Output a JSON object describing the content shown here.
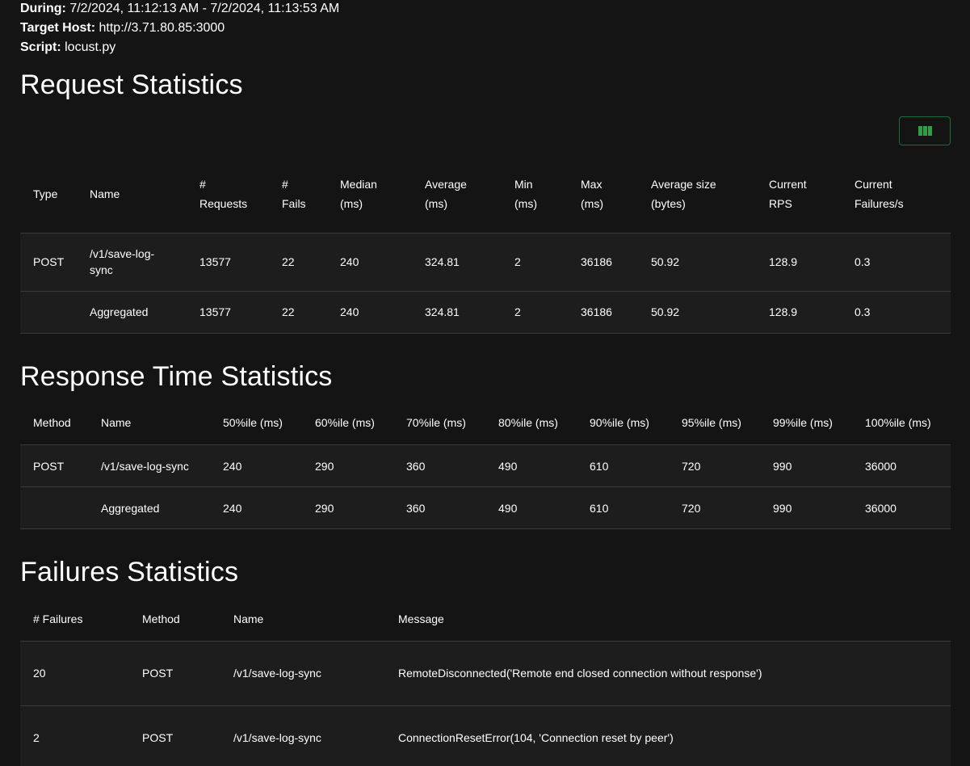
{
  "meta": {
    "during_label": "During:",
    "during_value": "7/2/2024, 11:12:13 AM - 7/2/2024, 11:13:53 AM",
    "host_label": "Target Host:",
    "host_value": "http://3.71.80.85:3000",
    "script_label": "Script:",
    "script_value": "locust.py"
  },
  "request_stats": {
    "title": "Request Statistics",
    "column_toggle_icon": "columns-icon",
    "headers": {
      "type": "Type",
      "name": "Name",
      "requests_1": "#",
      "requests_2": "Requests",
      "fails_1": "#",
      "fails_2": "Fails",
      "median_1": "Median",
      "median_2": "(ms)",
      "average_1": "Average",
      "average_2": "(ms)",
      "min_1": "Min",
      "min_2": "(ms)",
      "max_1": "Max",
      "max_2": "(ms)",
      "avg_size_1": "Average size",
      "avg_size_2": "(bytes)",
      "rps_1": "Current",
      "rps_2": "RPS",
      "failures_s_1": "Current",
      "failures_s_2": "Failures/s"
    },
    "rows": [
      {
        "type": "POST",
        "name_1": "/v1/save-log-",
        "name_2": "sync",
        "requests": "13577",
        "fails": "22",
        "median": "240",
        "average": "324.81",
        "min": "2",
        "max": "36186",
        "avg_size": "50.92",
        "rps": "128.9",
        "failures_s": "0.3"
      },
      {
        "type": "",
        "name": "Aggregated",
        "requests": "13577",
        "fails": "22",
        "median": "240",
        "average": "324.81",
        "min": "2",
        "max": "36186",
        "avg_size": "50.92",
        "rps": "128.9",
        "failures_s": "0.3"
      }
    ]
  },
  "response_stats": {
    "title": "Response Time Statistics",
    "headers": {
      "method": "Method",
      "name": "Name",
      "p50": "50%ile (ms)",
      "p60": "60%ile (ms)",
      "p70": "70%ile (ms)",
      "p80": "80%ile (ms)",
      "p90": "90%ile (ms)",
      "p95": "95%ile (ms)",
      "p99": "99%ile (ms)",
      "p100": "100%ile (ms)"
    },
    "rows": [
      {
        "method": "POST",
        "name": "/v1/save-log-sync",
        "p50": "240",
        "p60": "290",
        "p70": "360",
        "p80": "490",
        "p90": "610",
        "p95": "720",
        "p99": "990",
        "p100": "36000"
      },
      {
        "method": "",
        "name": "Aggregated",
        "p50": "240",
        "p60": "290",
        "p70": "360",
        "p80": "490",
        "p90": "610",
        "p95": "720",
        "p99": "990",
        "p100": "36000"
      }
    ]
  },
  "failure_stats": {
    "title": "Failures Statistics",
    "headers": {
      "failures": "# Failures",
      "method": "Method",
      "name": "Name",
      "message": "Message"
    },
    "rows": [
      {
        "failures": "20",
        "method": "POST",
        "name": "/v1/save-log-sync",
        "message": "RemoteDisconnected('Remote end closed connection without response')"
      },
      {
        "failures": "2",
        "method": "POST",
        "name": "/v1/save-log-sync",
        "message": "ConnectionResetError(104, 'Connection reset by peer')"
      }
    ]
  }
}
